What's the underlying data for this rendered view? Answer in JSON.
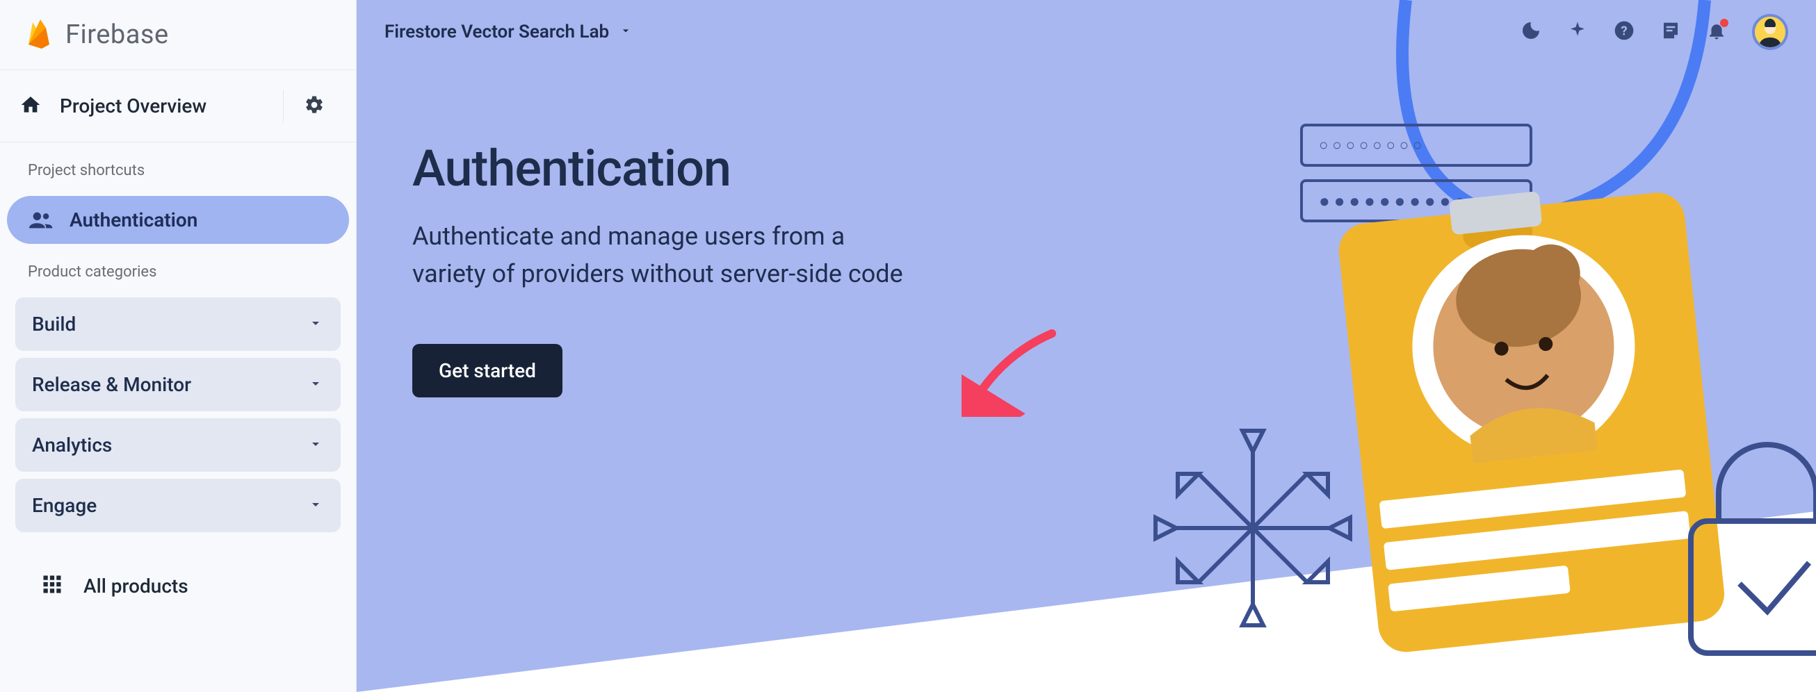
{
  "brand": {
    "name": "Firebase"
  },
  "sidebar": {
    "overview_label": "Project Overview",
    "shortcuts_heading": "Project shortcuts",
    "shortcuts": [
      {
        "label": "Authentication",
        "active": true,
        "icon": "people-icon"
      }
    ],
    "categories_heading": "Product categories",
    "categories": [
      {
        "label": "Build"
      },
      {
        "label": "Release & Monitor"
      },
      {
        "label": "Analytics"
      },
      {
        "label": "Engage"
      }
    ],
    "all_products_label": "All products"
  },
  "topbar": {
    "project_name": "Firestore Vector Search Lab"
  },
  "hero": {
    "title": "Authentication",
    "subtitle": "Authenticate and manage users from a variety of providers without server-side code",
    "cta_label": "Get started"
  },
  "colors": {
    "hero_bg": "#a8b7f0",
    "sidebar_active_bg": "#9fb4f0",
    "cta_bg": "#172236",
    "arrow": "#f43f5e",
    "brand_yellow": "#ffca28",
    "brand_orange": "#ffa000"
  }
}
